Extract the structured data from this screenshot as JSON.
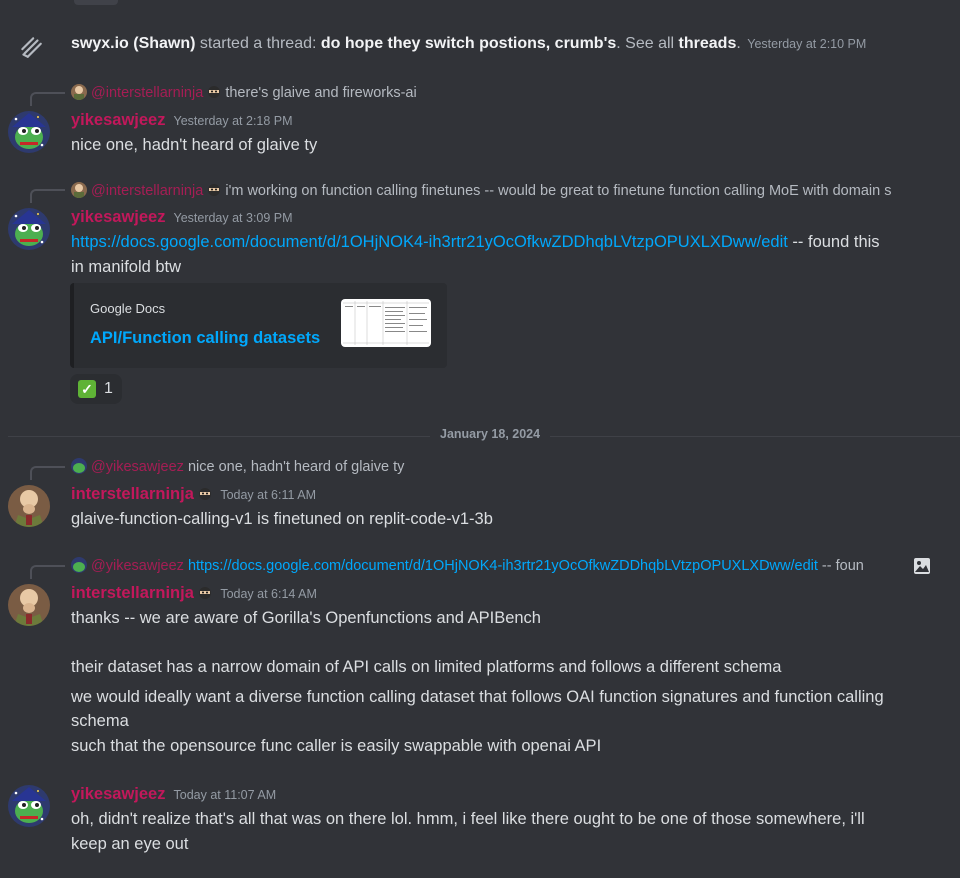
{
  "system_message": {
    "actor": "swyx.io (Shawn)",
    "action_text": "started a thread:",
    "thread_name": "do hope they switch postions, crumb's",
    "see_all": ". See all",
    "threads_link": "threads",
    "period": ".",
    "timestamp": "Yesterday at 2:10 PM"
  },
  "messages": [
    {
      "reply": {
        "mention": "@interstellarninja",
        "text": "there's glaive and fireworks-ai"
      },
      "author": "yikesawjeez",
      "timestamp": "Yesterday at 2:18 PM",
      "text": "nice one, hadn't heard of glaive ty"
    },
    {
      "reply": {
        "mention": "@interstellarninja",
        "text": "i'm working on function calling finetunes -- would be great to finetune function calling MoE with domain s"
      },
      "author": "yikesawjeez",
      "timestamp": "Yesterday at 3:09 PM",
      "link": "https://docs.google.com/document/d/1OHjNOK4-ih3rtr21yOcOfkwZDDhqbLVtzpOPUXLXDww/edit",
      "text_after_link": " -- found this",
      "text_line2": "in manifold btw",
      "embed": {
        "provider": "Google Docs",
        "title": "API/Function calling datasets"
      },
      "reaction": {
        "emoji": "✓",
        "count": "1"
      }
    },
    {
      "reply": {
        "mention": "@yikesawjeez",
        "text": "nice one, hadn't heard of glaive ty"
      },
      "author": "interstellarninja",
      "timestamp": "Today at 6:11 AM",
      "text": "glaive-function-calling-v1 is finetuned on replit-code-v1-3b"
    },
    {
      "reply": {
        "mention": "@yikesawjeez",
        "link": "https://docs.google.com/document/d/1OHjNOK4-ih3rtr21yOcOfkwZDDhqbLVtzpOPUXLXDww/edit",
        "text": " -- foun"
      },
      "author": "interstellarninja",
      "timestamp": "Today at 6:14 AM",
      "lines": [
        "thanks -- we are aware of Gorilla's Openfunctions and APIBench",
        "their dataset has a narrow domain of API calls on limited platforms and follows a different schema",
        "we would ideally want a diverse function calling dataset that follows OAI function signatures and function calling",
        "schema",
        "such that the opensource func caller is easily swappable with openai API"
      ]
    },
    {
      "author": "yikesawjeez",
      "timestamp": "Today at 11:07 AM",
      "lines": [
        "oh, didn't realize that's all that was on there lol. hmm, i feel like there ought to be one of those somewhere, i'll",
        "keep an eye out"
      ]
    }
  ],
  "date_divider": "January 18, 2024",
  "colors": {
    "background": "#313338",
    "username_pink": "#c2185b",
    "link_blue": "#00a8fc",
    "text": "#dbdee1",
    "muted": "#949ba4"
  },
  "icons": [
    "thread-icon",
    "avatar-frog",
    "avatar-monk",
    "ninja-emoji",
    "check-emoji",
    "image-icon"
  ]
}
